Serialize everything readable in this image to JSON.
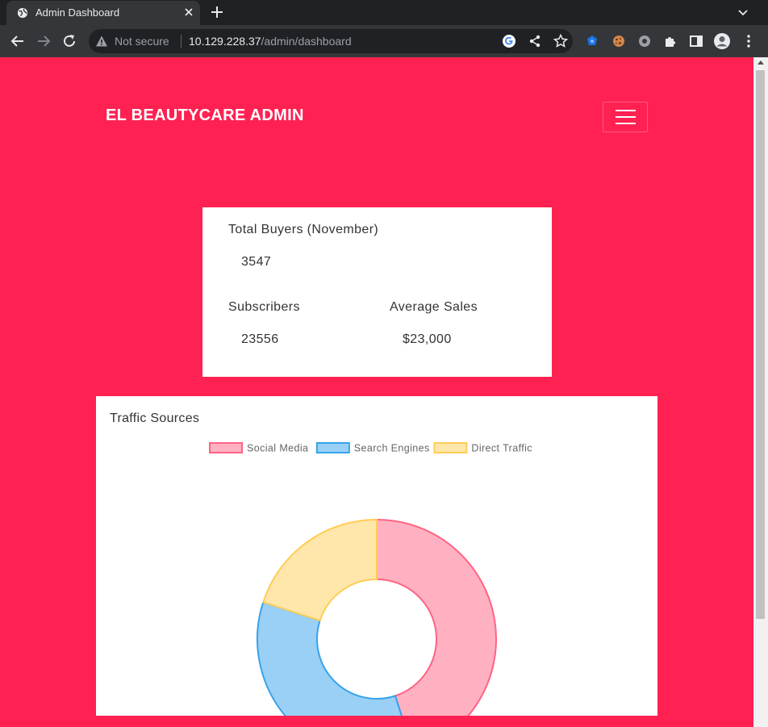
{
  "browser": {
    "tab_title": "Admin Dashboard",
    "security_text": "Not secure",
    "url_host": "10.129.228.37",
    "url_path": "/admin/dashboard"
  },
  "header": {
    "brand": "EL BEAUTYCARE ADMIN"
  },
  "stats": {
    "total_buyers_label": "Total Buyers (November)",
    "total_buyers_value": "3547",
    "subscribers_label": "Subscribers",
    "subscribers_value": "23556",
    "average_sales_label": "Average Sales",
    "average_sales_value": "$23,000"
  },
  "traffic": {
    "title": "Traffic Sources"
  },
  "chart_data": {
    "type": "pie",
    "variant": "doughnut",
    "title": "Traffic Sources",
    "legend_position": "top",
    "categories": [
      "Social Media",
      "Search Engines",
      "Direct Traffic"
    ],
    "values": [
      45,
      35,
      20
    ],
    "colors": {
      "fill": [
        "#ffb1c1",
        "#9ad0f5",
        "#ffe6aa"
      ],
      "border": [
        "#ff6384",
        "#36a2eb",
        "#ffcd56"
      ]
    }
  }
}
